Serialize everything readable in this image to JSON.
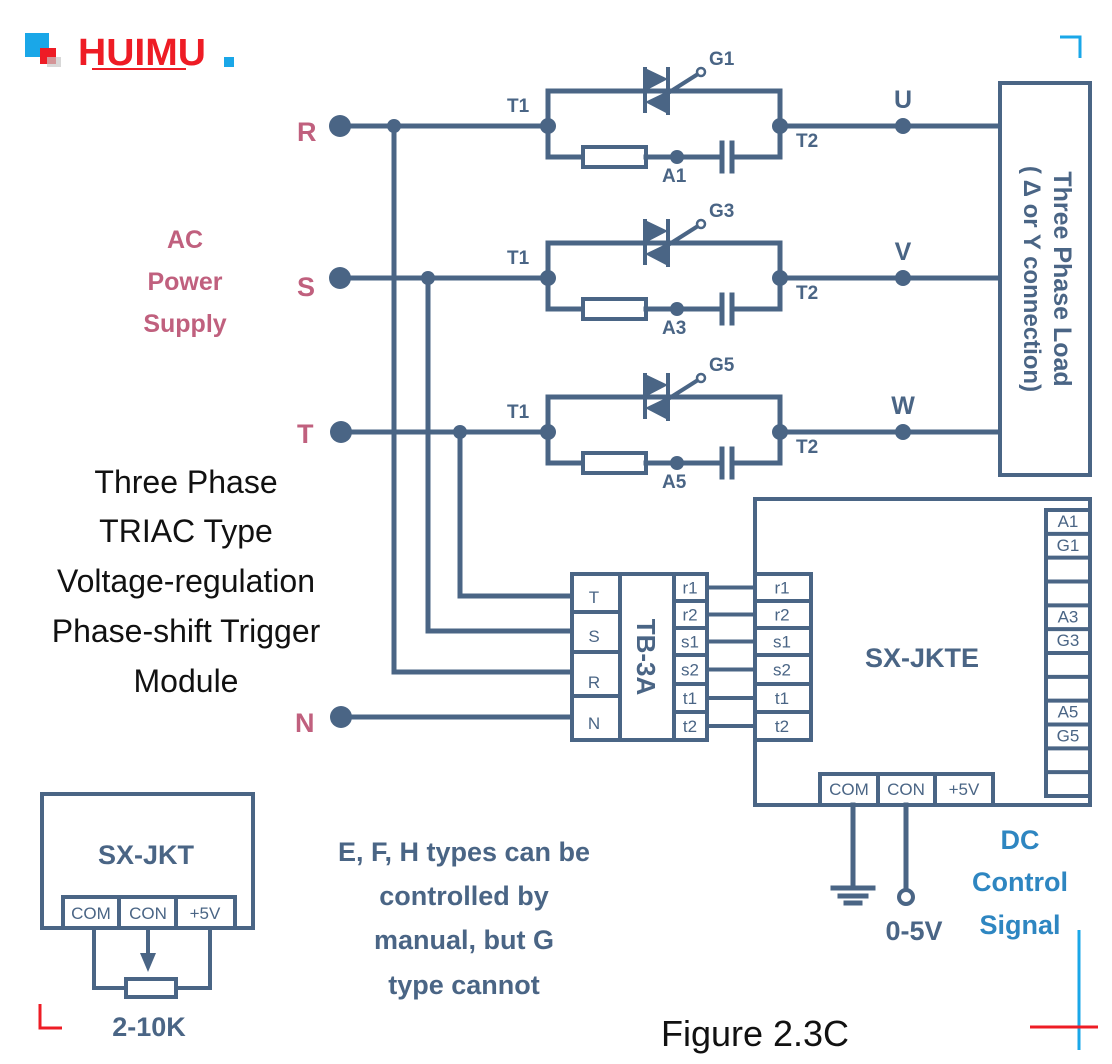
{
  "logo": {
    "text": "HUIMU",
    "color": "#ee1c25",
    "accent": "#1aa7e8"
  },
  "colors": {
    "wire": "#4a6585",
    "supply_label": "#c0607e",
    "dc_label": "#2e86c1",
    "text": "#111111"
  },
  "supply": {
    "title_lines": [
      "AC",
      "Power",
      "Supply"
    ],
    "phases": [
      "R",
      "S",
      "T"
    ],
    "neutral": "N"
  },
  "module_title_lines": [
    "Three Phase",
    "TRIAC Type",
    "Voltage-regulation",
    "Phase-shift Trigger",
    "Module"
  ],
  "branches": [
    {
      "t1": "T1",
      "t2": "T2",
      "gate": "G1",
      "snubber": "A1",
      "output": "U"
    },
    {
      "t1": "T1",
      "t2": "T2",
      "gate": "G3",
      "snubber": "A3",
      "output": "V"
    },
    {
      "t1": "T1",
      "t2": "T2",
      "gate": "G5",
      "snubber": "A5",
      "output": "W"
    }
  ],
  "load": {
    "title": "Three Phase Load",
    "subtitle": "( Δ or Y connection)"
  },
  "tb3a": {
    "name": "TB-3A",
    "inputs": [
      "T",
      "S",
      "R",
      "N"
    ],
    "outputs": [
      "r1",
      "r2",
      "s1",
      "s2",
      "t1",
      "t2"
    ]
  },
  "sxjkte": {
    "name": "SX-JKTE",
    "inputs": [
      "r1",
      "r2",
      "s1",
      "s2",
      "t1",
      "t2"
    ],
    "right_pins": [
      "A1",
      "G1",
      "",
      "",
      "A3",
      "G3",
      "",
      "",
      "A5",
      "G5",
      "",
      ""
    ],
    "bottom_pins": [
      "COM",
      "CON",
      "+5V"
    ]
  },
  "dc_control": {
    "signal_range": "0-5V",
    "label_lines": [
      "DC",
      "Control",
      "Signal"
    ]
  },
  "sxjkt": {
    "name": "SX-JKT",
    "pins": [
      "COM",
      "CON",
      "+5V"
    ],
    "pot_value": "2-10K"
  },
  "note_lines": [
    "E, F, H types can be",
    "controlled by",
    "manual, but G",
    "type cannot"
  ],
  "caption": "Figure 2.3C"
}
